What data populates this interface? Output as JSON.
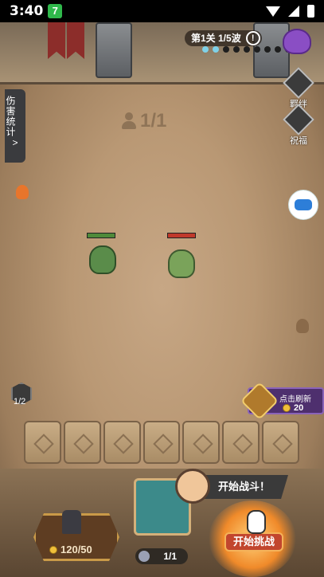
{
  "status_bar": {
    "time": "3:40",
    "app_badge": "7"
  },
  "hud": {
    "wave_label": "第1关 1/5波",
    "warn_glyph": "!",
    "wave_dots": 10,
    "current_wave_dots": 2,
    "damage_stats_label": "伤害统计",
    "damage_stats_arrow": ">",
    "player_count": "1/1",
    "side_buttons": [
      {
        "label": "羁绊",
        "icon": "gem-icon"
      },
      {
        "label": "祝福",
        "icon": "gem-icon"
      }
    ]
  },
  "units": {
    "hero": {
      "hp": 1.0,
      "hp_color": "#4e8a3a"
    },
    "enemy": {
      "hp": 1.0,
      "hp_color": "#c0392b"
    }
  },
  "refresh": {
    "title": "点击刷新",
    "cost": "20"
  },
  "bench": {
    "slot_count_label": "1/2",
    "slots": 7
  },
  "bottom": {
    "speech": "开始战斗！",
    "gold": "120/50",
    "capacity": "1/1",
    "start_button": "开始挑战"
  }
}
